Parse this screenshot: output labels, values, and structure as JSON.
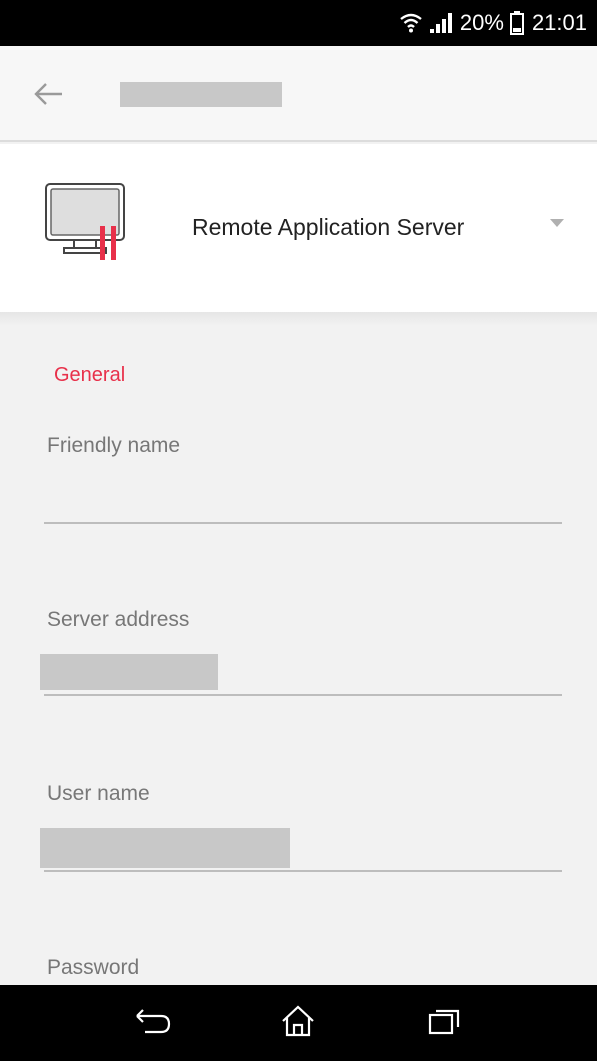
{
  "status_bar": {
    "battery_percent": "20%",
    "time": "21:01",
    "icons": [
      "wifi-icon",
      "signal-icon",
      "battery-icon"
    ]
  },
  "app_bar": {
    "back_icon": "arrow-left-icon",
    "title": ""
  },
  "server_type": {
    "icon": "monitor-icon",
    "selected": "Remote Application Server"
  },
  "form": {
    "section_title": "General",
    "fields": [
      {
        "label": "Friendly name",
        "value": ""
      },
      {
        "label": "Server address",
        "value": ""
      },
      {
        "label": "User name",
        "value": ""
      },
      {
        "label": "Password",
        "value": ""
      }
    ]
  },
  "nav_bar": {
    "icons": [
      "back-nav-icon",
      "home-icon",
      "recents-icon"
    ]
  },
  "colors": {
    "accent": "#e8304a",
    "status_bar": "#000000",
    "app_bar": "#f7f7f7"
  }
}
